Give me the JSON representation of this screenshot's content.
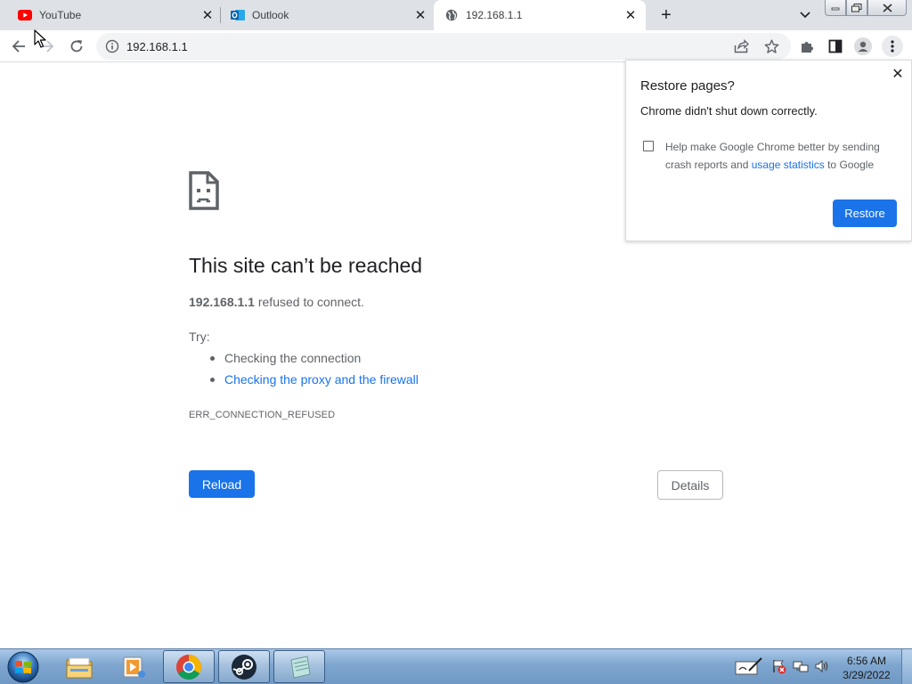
{
  "tabs": [
    {
      "title": "YouTube",
      "favicon": "youtube-icon",
      "active": false
    },
    {
      "title": "Outlook",
      "favicon": "outlook-icon",
      "active": false
    },
    {
      "title": "192.168.1.1",
      "favicon": "globe-icon",
      "active": true
    }
  ],
  "window_controls": {
    "minimize": "minimize",
    "maximize": "restore-down",
    "close": "close"
  },
  "toolbar": {
    "url": "192.168.1.1"
  },
  "error_page": {
    "title": "This site can’t be reached",
    "host": "192.168.1.1",
    "message": " refused to connect.",
    "try_label": "Try:",
    "suggestions": [
      "Checking the connection",
      "Checking the proxy and the firewall"
    ],
    "error_code": "ERR_CONNECTION_REFUSED",
    "reload_label": "Reload",
    "details_label": "Details"
  },
  "restore_bubble": {
    "title": "Restore pages?",
    "message": "Chrome didn't shut down correctly.",
    "help_text_before": "Help make Google Chrome better by sending crash reports and ",
    "help_link": "usage statistics",
    "help_text_after": " to Google",
    "checkbox_checked": false,
    "restore_label": "Restore"
  },
  "taskbar": {
    "time": "6:56 AM",
    "date": "3/29/2022",
    "apps": [
      "file-explorer-icon",
      "media-player-icon",
      "chrome-icon",
      "steam-icon",
      "notepad-icon"
    ]
  },
  "colors": {
    "accent": "#1a73e8",
    "tabstrip": "#dee1e6",
    "text_secondary": "#5f6368"
  }
}
